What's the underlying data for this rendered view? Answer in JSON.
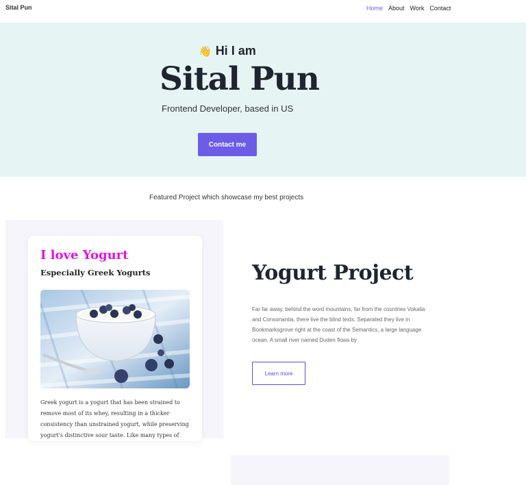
{
  "nav": {
    "brand": "Sital Pun",
    "links": [
      {
        "label": "Home",
        "active": true
      },
      {
        "label": "About",
        "active": false
      },
      {
        "label": "Work",
        "active": false
      },
      {
        "label": "Contact",
        "active": false
      }
    ]
  },
  "hero": {
    "wave_emoji": "👋",
    "greeting": "Hi I am",
    "name": "Sital Pun",
    "role": "Frontend Developer, based in US",
    "button_label": "Contact me"
  },
  "featured": {
    "intro": "Featured Project which showcase my best projects"
  },
  "card": {
    "title": "I love Yogurt",
    "subtitle": "Especially Greek Yogurts",
    "text": "Greek yogurt is a yogurt that has been strained to remove most of its whey, resulting in a thicker consistency than unstrained yogurt, while preserving yogurt's distinctive sour taste. Like many types of yogurt, strained yogurt is"
  },
  "project": {
    "title": "Yogurt Project",
    "description": "Far far away, behind the word mountains, far from the countries Vokalia and Consonantia, there live the blind texts. Separated they live in Bookmarksgrove right at the coast of the Semantics, a large language ocean. A small river named Duden flows by",
    "button_label": "Learn more"
  },
  "colors": {
    "accent": "#6c5ce7",
    "hero_bg": "#e7f4f4",
    "card_title": "#e510e5"
  }
}
